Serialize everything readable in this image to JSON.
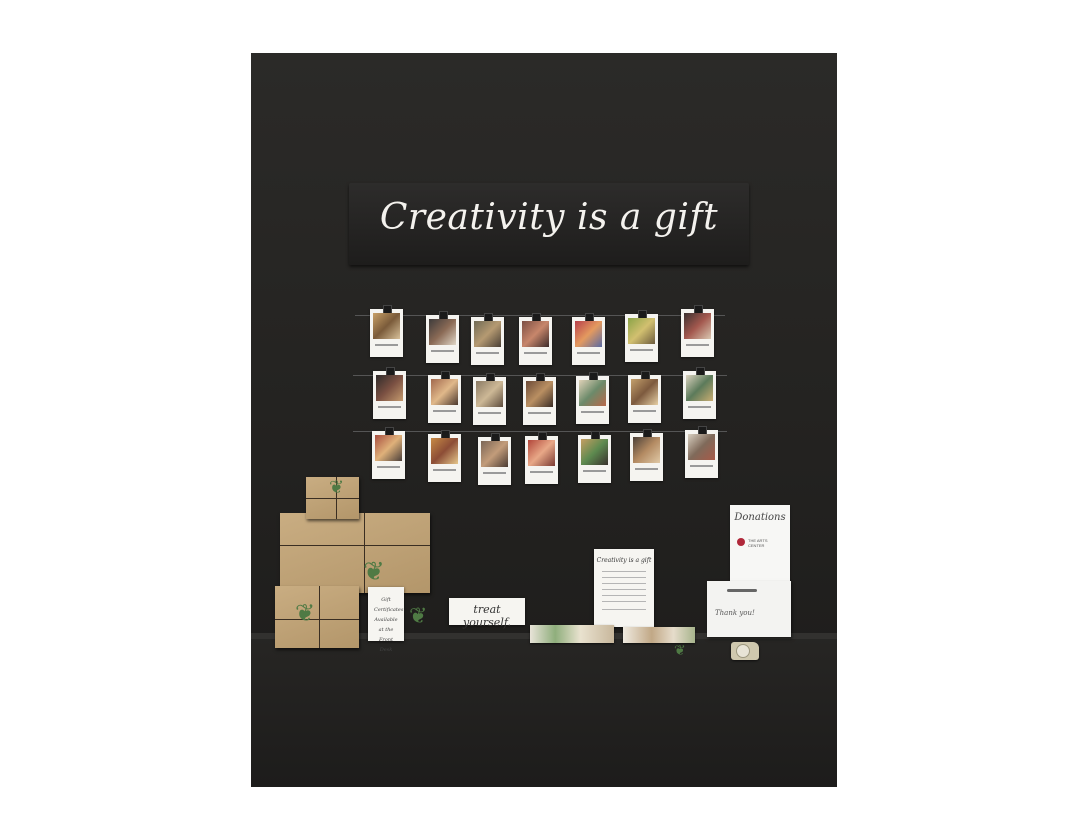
{
  "banner": {
    "text": "Creativity is a gift"
  },
  "gift_certificate_sign": {
    "text": "Gift Certificates Available at the Front Desk"
  },
  "treat_card": {
    "text": "treat yourself."
  },
  "info_sign": {
    "title": "Creativity is a gift"
  },
  "donation_box": {
    "title": "Donations",
    "logo_text": "THE ARTS CENTER",
    "thanks_text": "Thank you!"
  },
  "colors": {
    "wall": "#232220",
    "banner": "#1e1d1c",
    "kraft_paper": "#bfa277",
    "tablecloth": "#1d1c1b",
    "card_white": "#f6f5f1",
    "logo_red": "#b0283a"
  },
  "photo_rows": [
    {
      "count": 7
    },
    {
      "count": 7
    },
    {
      "count": 7
    }
  ]
}
